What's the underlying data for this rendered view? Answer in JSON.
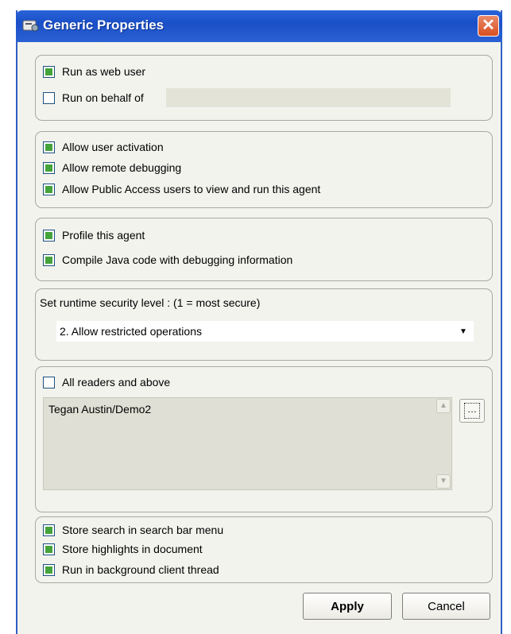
{
  "window": {
    "title": "Generic Properties",
    "close_glyph": "✕"
  },
  "group_run": {
    "run_as_web_user": {
      "label": "Run as web user",
      "checked": true
    },
    "run_on_behalf_of": {
      "label": "Run on behalf of",
      "checked": false,
      "value": ""
    }
  },
  "group_allow": {
    "items": [
      {
        "label": "Allow user activation",
        "checked": true
      },
      {
        "label": "Allow remote debugging",
        "checked": true
      },
      {
        "label": "Allow Public Access users to view and run this agent",
        "checked": true
      }
    ]
  },
  "group_profile": {
    "items": [
      {
        "label": "Profile this agent",
        "checked": true
      },
      {
        "label": "Compile Java code with debugging  information",
        "checked": true
      }
    ]
  },
  "group_security": {
    "label": "Set runtime security level : (1 =  most secure)",
    "selected": "2. Allow restricted operations",
    "arrow_glyph": "▼"
  },
  "group_readers": {
    "all_readers": {
      "label": "All readers and above",
      "checked": false
    },
    "list_items": [
      "Tegan Austin/Demo2"
    ],
    "picker_glyph": "…"
  },
  "group_search": {
    "items": [
      {
        "label": "Store search in search bar menu",
        "checked": true
      },
      {
        "label": "Store highlights in document",
        "checked": true
      },
      {
        "label": "Run in background client thread",
        "checked": true
      }
    ]
  },
  "buttons": {
    "apply": "Apply",
    "cancel": "Cancel"
  },
  "colors": {
    "titlebar": "#1a4fc8",
    "check_fill": "#44a33b",
    "dialog_bg": "#f3f3ee",
    "close": "#d94e20"
  }
}
